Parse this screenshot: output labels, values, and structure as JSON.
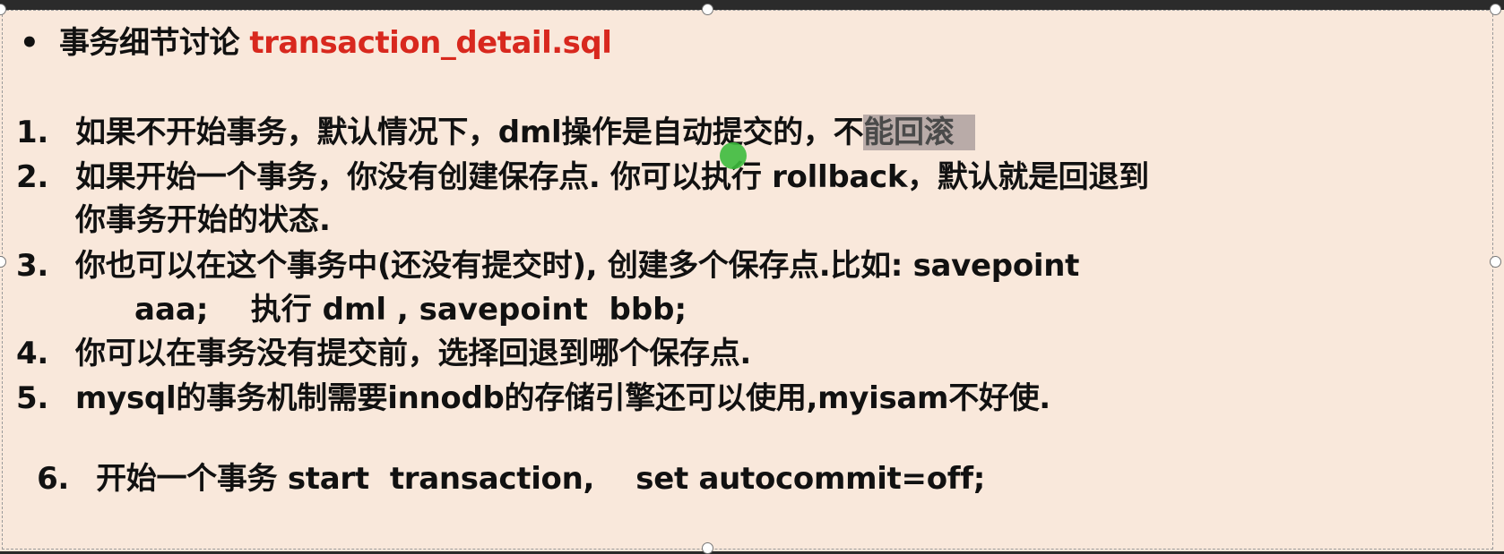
{
  "slide": {
    "title": {
      "bullet": "•",
      "text": "事务细节讨论",
      "filename": "transaction_detail.sql",
      "filename_color": "#d8281e"
    },
    "items": [
      {
        "num": "1.",
        "text": "如果不开始事务，默认情况下，dml操作是自动提交的，不",
        "highlighted": "能回滚"
      },
      {
        "num": "2.",
        "text": "如果开始一个事务，你没有创建保存点. 你可以执行 rollback，默认就是回退到",
        "cont": "你事务开始的状态."
      },
      {
        "num": "3.",
        "text": "你也可以在这个事务中(还没有提交时), 创建多个保存点.比如: savepoint",
        "cont": "aaa;    执行 dml , savepoint  bbb;"
      },
      {
        "num": "4.",
        "text": "你可以在事务没有提交前，选择回退到哪个保存点."
      },
      {
        "num": "5.",
        "text": "mysql的事务机制需要innodb的存储引擎还可以使用,myisam不好使."
      },
      {
        "num": "6.",
        "text": "开始一个事务 start  transaction,    set autocommit=off;"
      }
    ]
  },
  "colors": {
    "background": "#f9e8db",
    "highlight": "#b9aba8",
    "cursor": "#3dbb3d"
  }
}
